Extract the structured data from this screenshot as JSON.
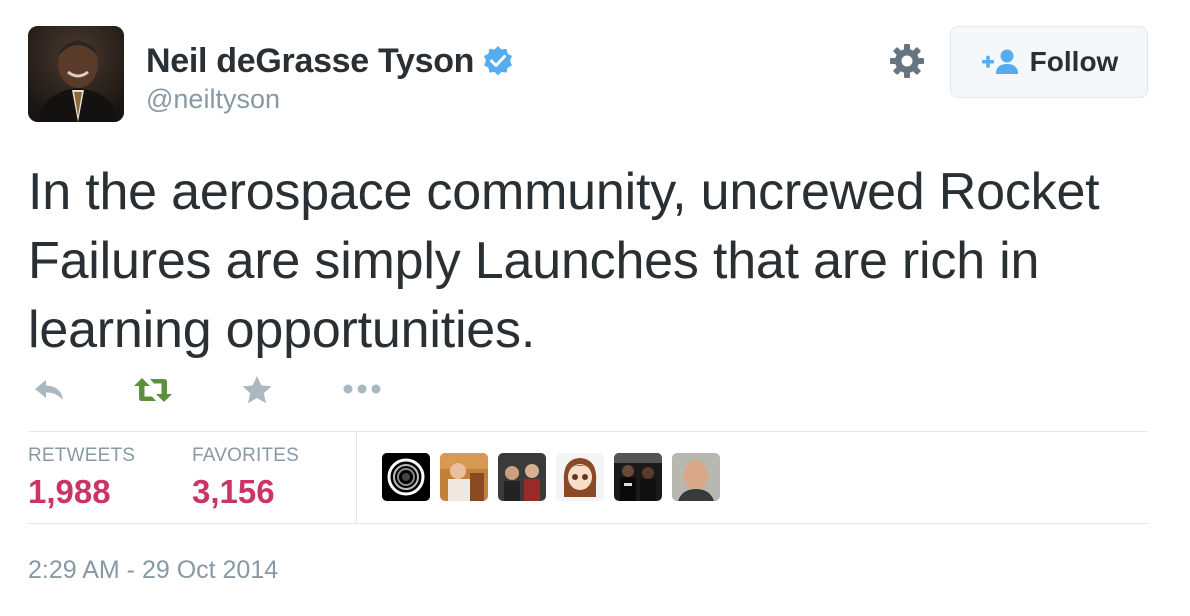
{
  "author": {
    "name": "Neil deGrasse Tyson",
    "handle": "@neiltyson",
    "verified": true,
    "verified_color": "#55acee"
  },
  "header": {
    "settings_icon": "gear-icon",
    "follow_label": "Follow",
    "follow_icon": "add-user-icon",
    "follow_icon_color": "#55acee"
  },
  "tweet": {
    "text": "In the aerospace community, uncrewed Rocket Failures are simply Launches that are rich in learning opportunities."
  },
  "actions": {
    "reply_icon": "reply-icon",
    "retweet_icon": "retweet-icon",
    "retweet_color": "#5c913b",
    "favorite_icon": "star-icon",
    "more_icon": "ellipsis-icon"
  },
  "stats": {
    "retweets_label": "RETWEETS",
    "retweets_value": "1,988",
    "favorites_label": "FAVORITES",
    "favorites_value": "3,156",
    "value_color": "#cc3366"
  },
  "favoriters": [
    {
      "name": "favoriter-avatar-1"
    },
    {
      "name": "favoriter-avatar-2"
    },
    {
      "name": "favoriter-avatar-3"
    },
    {
      "name": "favoriter-avatar-4"
    },
    {
      "name": "favoriter-avatar-5"
    },
    {
      "name": "favoriter-avatar-6"
    }
  ],
  "timestamp": "2:29 AM - 29 Oct 2014"
}
